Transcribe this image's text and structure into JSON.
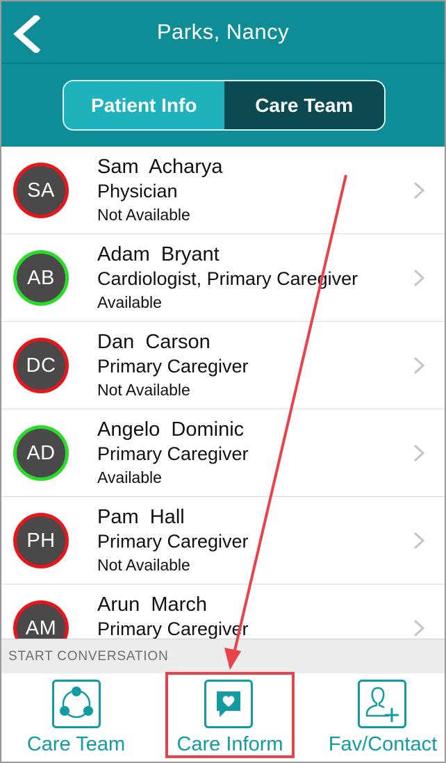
{
  "header": {
    "title": "Parks, Nancy",
    "back_icon": "chevron-left-icon",
    "tabs": [
      {
        "label": "Patient Info",
        "selected": false
      },
      {
        "label": "Care Team",
        "selected": true
      }
    ]
  },
  "care_team": [
    {
      "initials": "SA",
      "name": "Sam  Acharya",
      "role": "Physician",
      "status": "Not Available",
      "status_color": "#e8161a"
    },
    {
      "initials": "AB",
      "name": "Adam  Bryant",
      "role": "Cardiologist, Primary Caregiver",
      "status": "Available",
      "status_color": "#2bdb2b"
    },
    {
      "initials": "DC",
      "name": "Dan  Carson",
      "role": "Primary Caregiver",
      "status": "Not Available",
      "status_color": "#e8161a"
    },
    {
      "initials": "AD",
      "name": "Angelo  Dominic",
      "role": "Primary Caregiver",
      "status": "Available",
      "status_color": "#2bdb2b"
    },
    {
      "initials": "PH",
      "name": "Pam  Hall",
      "role": "Primary Caregiver",
      "status": "Not Available",
      "status_color": "#e8161a"
    },
    {
      "initials": "AM",
      "name": "Arun  March",
      "role": "Primary Caregiver",
      "status": "",
      "status_color": "#e8161a"
    }
  ],
  "start_conversation": {
    "label": "START CONVERSATION"
  },
  "toolbar": {
    "items": [
      {
        "label": "Care Team",
        "icon": "care-team-network-icon"
      },
      {
        "label": "Care Inform",
        "icon": "heart-message-icon"
      },
      {
        "label": "Fav/Contact",
        "icon": "add-contact-icon"
      }
    ]
  },
  "colors": {
    "header_bg": "#0f8d96",
    "accent": "#139ba4",
    "annotation": "#e8434b"
  }
}
